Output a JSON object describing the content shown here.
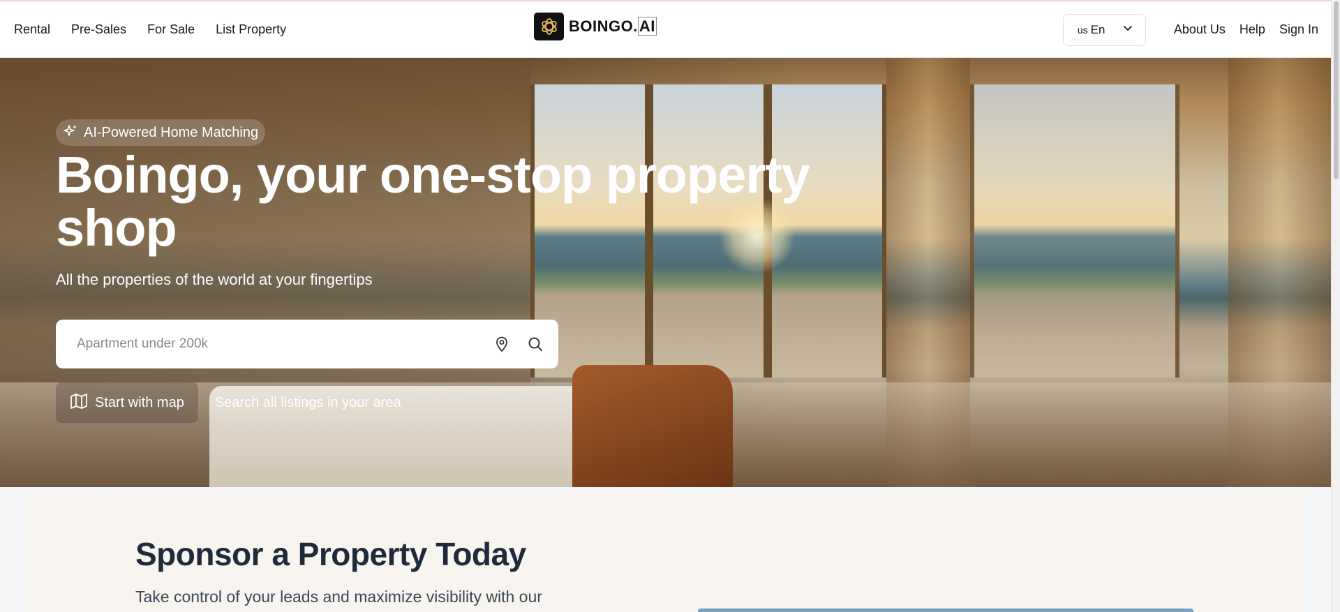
{
  "header": {
    "nav_left": [
      {
        "label": "Rental"
      },
      {
        "label": "Pre-Sales"
      },
      {
        "label": "For Sale"
      },
      {
        "label": "List Property"
      }
    ],
    "logo": {
      "brand": "BOINGO.",
      "suffix": "AI"
    },
    "language": {
      "country_code": "us",
      "label": "En"
    },
    "nav_right": [
      {
        "label": "About Us"
      },
      {
        "label": "Help"
      },
      {
        "label": "Sign In"
      }
    ]
  },
  "hero": {
    "badge": "AI-Powered Home Matching",
    "title": "Boingo, your one-stop property shop",
    "subtitle": "All the properties of the world at your fingertips",
    "search": {
      "placeholder": "Apartment under 200k",
      "value": ""
    },
    "map_button": "Start with map",
    "all_listings": "Search all listings in your area"
  },
  "sponsor": {
    "title": "Sponsor a Property Today",
    "text": "Take control of your leads and maximize visibility with our"
  },
  "colors": {
    "title_dark": "#1f2a3a",
    "sponsor_bg": "#f8f4ef",
    "white": "#ffffff"
  },
  "icons": [
    "boingo-logo-icon",
    "chevron-down-icon",
    "sparkles-icon",
    "location-pin-icon",
    "search-icon",
    "map-icon"
  ]
}
